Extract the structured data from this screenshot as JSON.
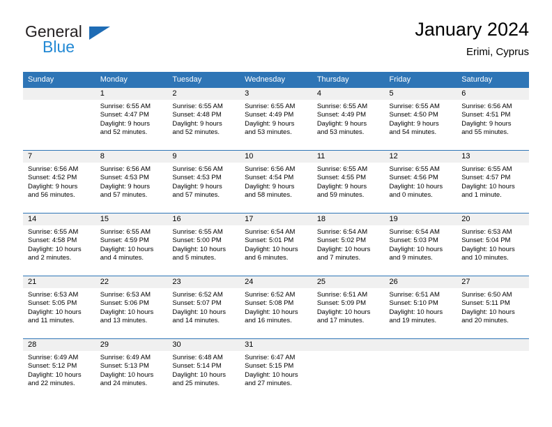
{
  "brand": {
    "name_part1": "General",
    "name_part2": "Blue",
    "logo_icon": "triangle-icon",
    "colors": {
      "triangle": "#1e6cb5",
      "blue_text": "#2389d4",
      "dark_text": "#231f20"
    }
  },
  "header": {
    "title": "January 2024",
    "location": "Erimi, Cyprus"
  },
  "theme": {
    "header_bg": "#2e75b6",
    "header_text": "#ffffff",
    "daynum_band_bg": "#f0f0f0",
    "row_border": "#2e75b6"
  },
  "weekdays": [
    "Sunday",
    "Monday",
    "Tuesday",
    "Wednesday",
    "Thursday",
    "Friday",
    "Saturday"
  ],
  "weeks": [
    [
      {
        "day": "",
        "sunrise": "",
        "sunset": "",
        "daylight_line1": "",
        "daylight_line2": ""
      },
      {
        "day": "1",
        "sunrise": "Sunrise: 6:55 AM",
        "sunset": "Sunset: 4:47 PM",
        "daylight_line1": "Daylight: 9 hours",
        "daylight_line2": "and 52 minutes."
      },
      {
        "day": "2",
        "sunrise": "Sunrise: 6:55 AM",
        "sunset": "Sunset: 4:48 PM",
        "daylight_line1": "Daylight: 9 hours",
        "daylight_line2": "and 52 minutes."
      },
      {
        "day": "3",
        "sunrise": "Sunrise: 6:55 AM",
        "sunset": "Sunset: 4:49 PM",
        "daylight_line1": "Daylight: 9 hours",
        "daylight_line2": "and 53 minutes."
      },
      {
        "day": "4",
        "sunrise": "Sunrise: 6:55 AM",
        "sunset": "Sunset: 4:49 PM",
        "daylight_line1": "Daylight: 9 hours",
        "daylight_line2": "and 53 minutes."
      },
      {
        "day": "5",
        "sunrise": "Sunrise: 6:55 AM",
        "sunset": "Sunset: 4:50 PM",
        "daylight_line1": "Daylight: 9 hours",
        "daylight_line2": "and 54 minutes."
      },
      {
        "day": "6",
        "sunrise": "Sunrise: 6:56 AM",
        "sunset": "Sunset: 4:51 PM",
        "daylight_line1": "Daylight: 9 hours",
        "daylight_line2": "and 55 minutes."
      }
    ],
    [
      {
        "day": "7",
        "sunrise": "Sunrise: 6:56 AM",
        "sunset": "Sunset: 4:52 PM",
        "daylight_line1": "Daylight: 9 hours",
        "daylight_line2": "and 56 minutes."
      },
      {
        "day": "8",
        "sunrise": "Sunrise: 6:56 AM",
        "sunset": "Sunset: 4:53 PM",
        "daylight_line1": "Daylight: 9 hours",
        "daylight_line2": "and 57 minutes."
      },
      {
        "day": "9",
        "sunrise": "Sunrise: 6:56 AM",
        "sunset": "Sunset: 4:53 PM",
        "daylight_line1": "Daylight: 9 hours",
        "daylight_line2": "and 57 minutes."
      },
      {
        "day": "10",
        "sunrise": "Sunrise: 6:56 AM",
        "sunset": "Sunset: 4:54 PM",
        "daylight_line1": "Daylight: 9 hours",
        "daylight_line2": "and 58 minutes."
      },
      {
        "day": "11",
        "sunrise": "Sunrise: 6:55 AM",
        "sunset": "Sunset: 4:55 PM",
        "daylight_line1": "Daylight: 9 hours",
        "daylight_line2": "and 59 minutes."
      },
      {
        "day": "12",
        "sunrise": "Sunrise: 6:55 AM",
        "sunset": "Sunset: 4:56 PM",
        "daylight_line1": "Daylight: 10 hours",
        "daylight_line2": "and 0 minutes."
      },
      {
        "day": "13",
        "sunrise": "Sunrise: 6:55 AM",
        "sunset": "Sunset: 4:57 PM",
        "daylight_line1": "Daylight: 10 hours",
        "daylight_line2": "and 1 minute."
      }
    ],
    [
      {
        "day": "14",
        "sunrise": "Sunrise: 6:55 AM",
        "sunset": "Sunset: 4:58 PM",
        "daylight_line1": "Daylight: 10 hours",
        "daylight_line2": "and 2 minutes."
      },
      {
        "day": "15",
        "sunrise": "Sunrise: 6:55 AM",
        "sunset": "Sunset: 4:59 PM",
        "daylight_line1": "Daylight: 10 hours",
        "daylight_line2": "and 4 minutes."
      },
      {
        "day": "16",
        "sunrise": "Sunrise: 6:55 AM",
        "sunset": "Sunset: 5:00 PM",
        "daylight_line1": "Daylight: 10 hours",
        "daylight_line2": "and 5 minutes."
      },
      {
        "day": "17",
        "sunrise": "Sunrise: 6:54 AM",
        "sunset": "Sunset: 5:01 PM",
        "daylight_line1": "Daylight: 10 hours",
        "daylight_line2": "and 6 minutes."
      },
      {
        "day": "18",
        "sunrise": "Sunrise: 6:54 AM",
        "sunset": "Sunset: 5:02 PM",
        "daylight_line1": "Daylight: 10 hours",
        "daylight_line2": "and 7 minutes."
      },
      {
        "day": "19",
        "sunrise": "Sunrise: 6:54 AM",
        "sunset": "Sunset: 5:03 PM",
        "daylight_line1": "Daylight: 10 hours",
        "daylight_line2": "and 9 minutes."
      },
      {
        "day": "20",
        "sunrise": "Sunrise: 6:53 AM",
        "sunset": "Sunset: 5:04 PM",
        "daylight_line1": "Daylight: 10 hours",
        "daylight_line2": "and 10 minutes."
      }
    ],
    [
      {
        "day": "21",
        "sunrise": "Sunrise: 6:53 AM",
        "sunset": "Sunset: 5:05 PM",
        "daylight_line1": "Daylight: 10 hours",
        "daylight_line2": "and 11 minutes."
      },
      {
        "day": "22",
        "sunrise": "Sunrise: 6:53 AM",
        "sunset": "Sunset: 5:06 PM",
        "daylight_line1": "Daylight: 10 hours",
        "daylight_line2": "and 13 minutes."
      },
      {
        "day": "23",
        "sunrise": "Sunrise: 6:52 AM",
        "sunset": "Sunset: 5:07 PM",
        "daylight_line1": "Daylight: 10 hours",
        "daylight_line2": "and 14 minutes."
      },
      {
        "day": "24",
        "sunrise": "Sunrise: 6:52 AM",
        "sunset": "Sunset: 5:08 PM",
        "daylight_line1": "Daylight: 10 hours",
        "daylight_line2": "and 16 minutes."
      },
      {
        "day": "25",
        "sunrise": "Sunrise: 6:51 AM",
        "sunset": "Sunset: 5:09 PM",
        "daylight_line1": "Daylight: 10 hours",
        "daylight_line2": "and 17 minutes."
      },
      {
        "day": "26",
        "sunrise": "Sunrise: 6:51 AM",
        "sunset": "Sunset: 5:10 PM",
        "daylight_line1": "Daylight: 10 hours",
        "daylight_line2": "and 19 minutes."
      },
      {
        "day": "27",
        "sunrise": "Sunrise: 6:50 AM",
        "sunset": "Sunset: 5:11 PM",
        "daylight_line1": "Daylight: 10 hours",
        "daylight_line2": "and 20 minutes."
      }
    ],
    [
      {
        "day": "28",
        "sunrise": "Sunrise: 6:49 AM",
        "sunset": "Sunset: 5:12 PM",
        "daylight_line1": "Daylight: 10 hours",
        "daylight_line2": "and 22 minutes."
      },
      {
        "day": "29",
        "sunrise": "Sunrise: 6:49 AM",
        "sunset": "Sunset: 5:13 PM",
        "daylight_line1": "Daylight: 10 hours",
        "daylight_line2": "and 24 minutes."
      },
      {
        "day": "30",
        "sunrise": "Sunrise: 6:48 AM",
        "sunset": "Sunset: 5:14 PM",
        "daylight_line1": "Daylight: 10 hours",
        "daylight_line2": "and 25 minutes."
      },
      {
        "day": "31",
        "sunrise": "Sunrise: 6:47 AM",
        "sunset": "Sunset: 5:15 PM",
        "daylight_line1": "Daylight: 10 hours",
        "daylight_line2": "and 27 minutes."
      },
      {
        "day": "",
        "sunrise": "",
        "sunset": "",
        "daylight_line1": "",
        "daylight_line2": ""
      },
      {
        "day": "",
        "sunrise": "",
        "sunset": "",
        "daylight_line1": "",
        "daylight_line2": ""
      },
      {
        "day": "",
        "sunrise": "",
        "sunset": "",
        "daylight_line1": "",
        "daylight_line2": ""
      }
    ]
  ]
}
